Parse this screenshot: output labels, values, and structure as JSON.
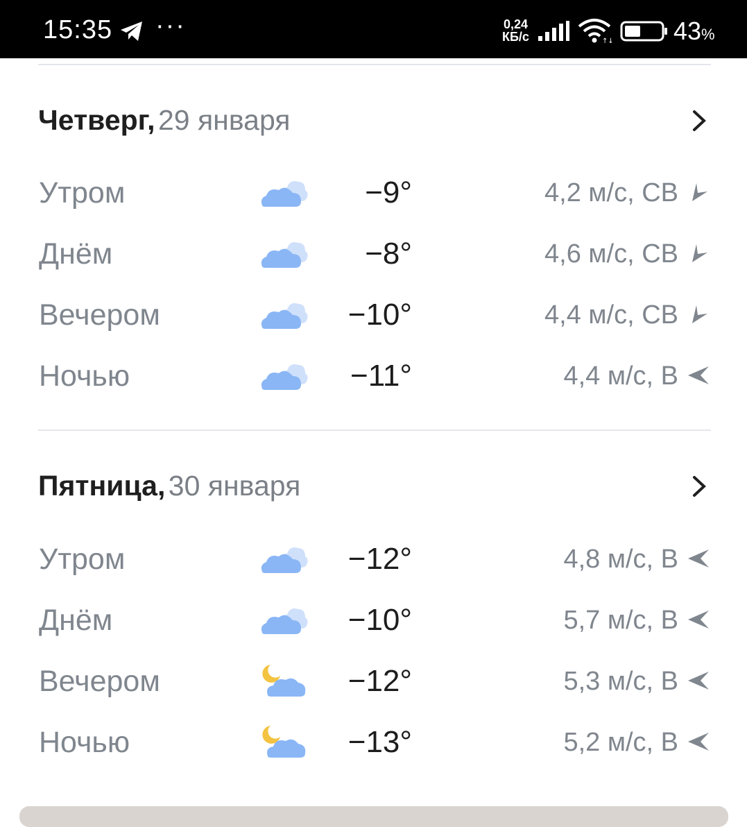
{
  "status_bar": {
    "time": "15:35",
    "dots": "···",
    "speed_value": "0,24",
    "speed_unit": "КБ/с",
    "battery_value": "43",
    "battery_unit": "%"
  },
  "days": [
    {
      "name": "Четверг,",
      "date": "29 января",
      "rows": [
        {
          "part": "Утром",
          "icon": "cloudy-icon",
          "temp": "−9°",
          "wind": "4,2 м/с, СВ",
          "wind_dir": "NE"
        },
        {
          "part": "Днём",
          "icon": "cloudy-icon",
          "temp": "−8°",
          "wind": "4,6 м/с, СВ",
          "wind_dir": "NE"
        },
        {
          "part": "Вечером",
          "icon": "cloudy-icon",
          "temp": "−10°",
          "wind": "4,4 м/с, СВ",
          "wind_dir": "NE"
        },
        {
          "part": "Ночью",
          "icon": "cloudy-icon",
          "temp": "−11°",
          "wind": "4,4 м/с, В",
          "wind_dir": "E"
        }
      ]
    },
    {
      "name": "Пятница,",
      "date": "30 января",
      "rows": [
        {
          "part": "Утром",
          "icon": "cloudy-icon",
          "temp": "−12°",
          "wind": "4,8 м/с, В",
          "wind_dir": "E"
        },
        {
          "part": "Днём",
          "icon": "cloudy-icon",
          "temp": "−10°",
          "wind": "5,7 м/с, В",
          "wind_dir": "E"
        },
        {
          "part": "Вечером",
          "icon": "moon-cloud-icon",
          "temp": "−12°",
          "wind": "5,3 м/с, В",
          "wind_dir": "E"
        },
        {
          "part": "Ночью",
          "icon": "moon-cloud-icon",
          "temp": "−13°",
          "wind": "5,2 м/с, В",
          "wind_dir": "E"
        }
      ]
    }
  ],
  "colors": {
    "cloud_front": "#8ab6f5",
    "cloud_back": "#cfe0fb",
    "moon": "#f3c341",
    "muted_text": "#80868e",
    "dark_text": "#1f1f1f"
  }
}
